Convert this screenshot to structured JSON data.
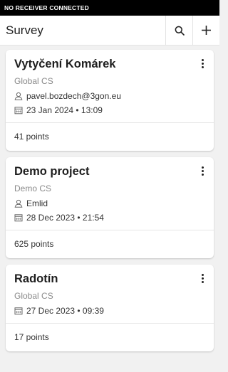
{
  "status_banner": "NO RECEIVER CONNECTED",
  "app_bar": {
    "title": "Survey",
    "search_icon": "search-icon",
    "add_icon": "plus-icon"
  },
  "projects": [
    {
      "name": "Vytyčení Komárek",
      "cs": "Global CS",
      "user": "pavel.bozdech@3gon.eu",
      "date": "23 Jan 2024 • 13:09",
      "points": "41 points"
    },
    {
      "name": "Demo project",
      "cs": "Demo CS",
      "user": "Emlid",
      "date": "28 Dec 2023 • 21:54",
      "points": "625 points"
    },
    {
      "name": "Radotín",
      "cs": "Global CS",
      "user": "",
      "date": "27 Dec 2023 • 09:39",
      "points": "17 points"
    }
  ]
}
